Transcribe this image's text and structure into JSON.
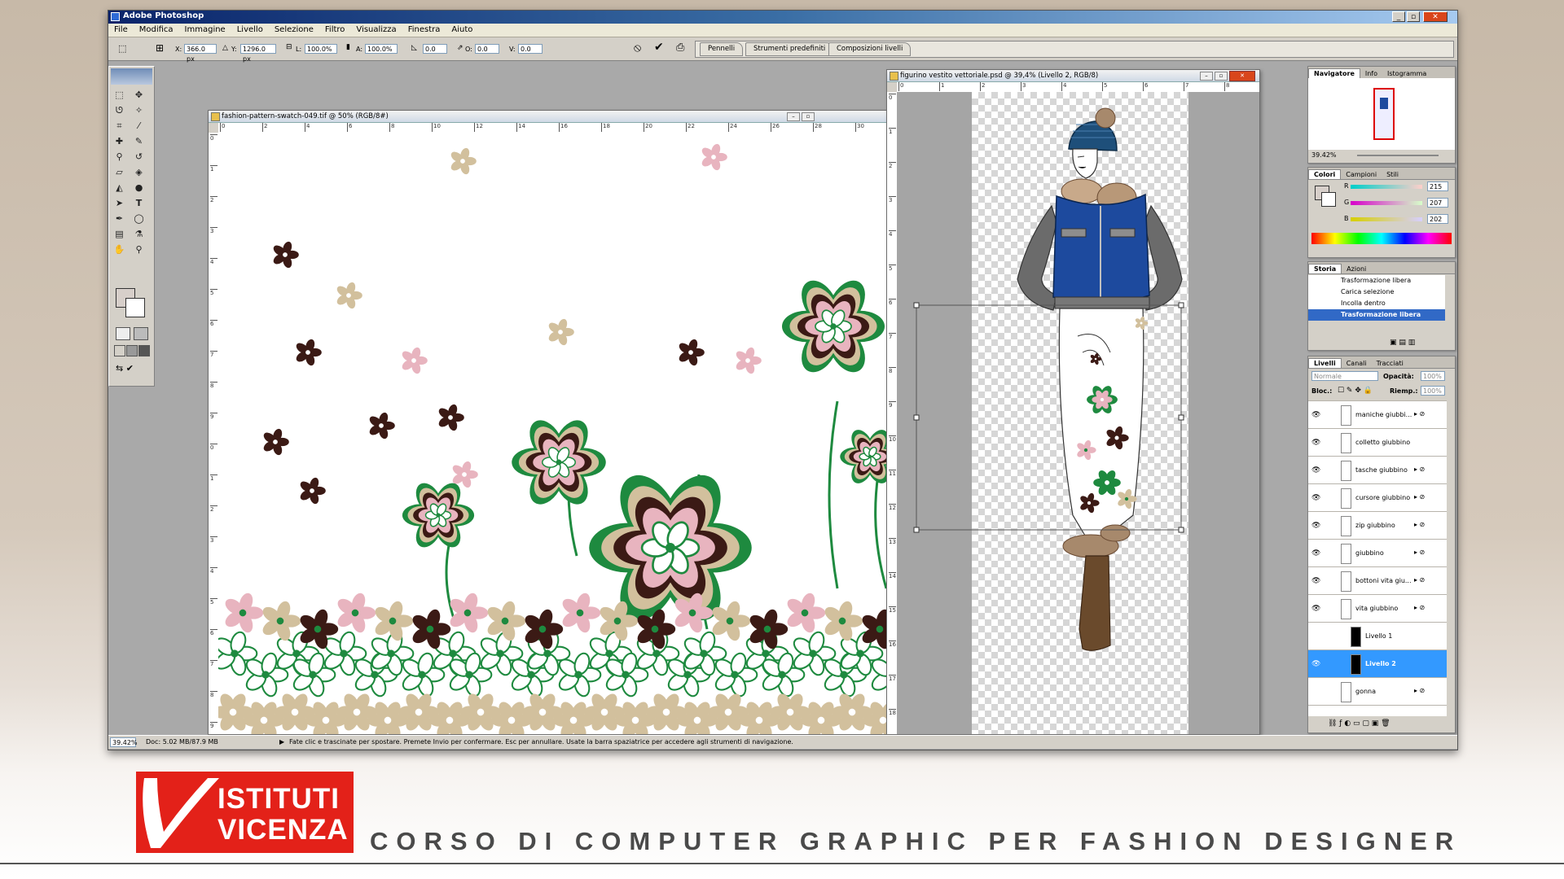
{
  "app": {
    "title": "Adobe Photoshop",
    "menu": [
      "File",
      "Modifica",
      "Immagine",
      "Livello",
      "Selezione",
      "Filtro",
      "Visualizza",
      "Finestra",
      "Aiuto"
    ]
  },
  "options_bar": {
    "x_label": "X:",
    "x_value": "366.0 px",
    "y_label": "Y:",
    "y_value": "1296.0 px",
    "l_label": "L:",
    "l_value": "100.0%",
    "a_label": "A:",
    "a_value": "100.0%",
    "angle_value": "0.0",
    "o_label": "O:",
    "o_value": "0.0",
    "v_label": "V:",
    "v_value": "0.0",
    "wells": [
      "Pennelli",
      "Strumenti predefiniti",
      "Composizioni livelli"
    ]
  },
  "doc_pattern": {
    "title": "fashion-pattern-swatch-049.tif @ 50% (RGB/8#)",
    "ruler_top": [
      "0",
      "2",
      "4",
      "6",
      "8",
      "10",
      "12",
      "14",
      "16",
      "18",
      "20",
      "22",
      "24",
      "26",
      "28",
      "30"
    ],
    "ruler_left": [
      "0",
      "1",
      "2",
      "3",
      "4",
      "5",
      "6",
      "7",
      "8",
      "9",
      "0",
      "1",
      "2",
      "3",
      "4",
      "5",
      "6",
      "7",
      "8",
      "9"
    ]
  },
  "doc_figure": {
    "title": "figurino vestito vettoriale.psd @ 39,4% (Livello 2, RGB/8)",
    "ruler_top": [
      "0",
      "1",
      "2",
      "3",
      "4",
      "5",
      "6",
      "7",
      "8"
    ],
    "ruler_left": [
      "0",
      "1",
      "2",
      "3",
      "4",
      "5",
      "6",
      "7",
      "8",
      "9",
      "10",
      "11",
      "12",
      "13",
      "14",
      "15",
      "16",
      "17",
      "18"
    ]
  },
  "navigator": {
    "tabs": [
      "Navigatore",
      "Info",
      "Istogramma"
    ],
    "zoom": "39.42%"
  },
  "colors": {
    "tabs": [
      "Colori",
      "Campioni",
      "Stili"
    ],
    "r_label": "R",
    "r_value": "215",
    "g_label": "G",
    "g_value": "207",
    "b_label": "B",
    "b_value": "202"
  },
  "history": {
    "tabs": [
      "Storia",
      "Azioni"
    ],
    "items": [
      "Trasformazione libera",
      "Carica selezione",
      "Incolla dentro",
      "Trasformazione libera"
    ]
  },
  "layers": {
    "tabs": [
      "Livelli",
      "Canali",
      "Tracciati"
    ],
    "blend": "Normale",
    "opacity_label": "Opacità:",
    "opacity": "100%",
    "lock_label": "Bloc.:",
    "fill_label": "Riemp.:",
    "fill": "100%",
    "items": [
      {
        "name": "maniche giubbi..."
      },
      {
        "name": "colletto giubbino"
      },
      {
        "name": "tasche giubbino"
      },
      {
        "name": "cursore giubbino"
      },
      {
        "name": "zip giubbino"
      },
      {
        "name": "giubbino"
      },
      {
        "name": "bottoni vita giu..."
      },
      {
        "name": "vita giubbino"
      },
      {
        "name": "Livello 1"
      },
      {
        "name": "Livello 2"
      },
      {
        "name": "gonna"
      }
    ]
  },
  "status": {
    "zoom": "39.42%",
    "doc": "Doc: 5.02 MB/87.9 MB",
    "hint": "Fate clic e trascinate per spostare. Premete Invio per confermare. Esc per annullare. Usate la barra spaziatrice per accedere agli strumenti di navigazione."
  },
  "branding": {
    "logo_line1": "ISTITUTI",
    "logo_line2": "VICENZA",
    "tagline": "CORSO DI COMPUTER GRAPHIC PER FASHION DESIGNER"
  },
  "palette": {
    "flower_green": "#1e8a3f",
    "flower_brown": "#3b1a15",
    "flower_pink": "#e8b4bf",
    "flower_beige": "#d2c09d",
    "jacket_blue": "#1d4a9e",
    "highlight_blue": "#3169c6",
    "brand_red": "#e32119"
  }
}
